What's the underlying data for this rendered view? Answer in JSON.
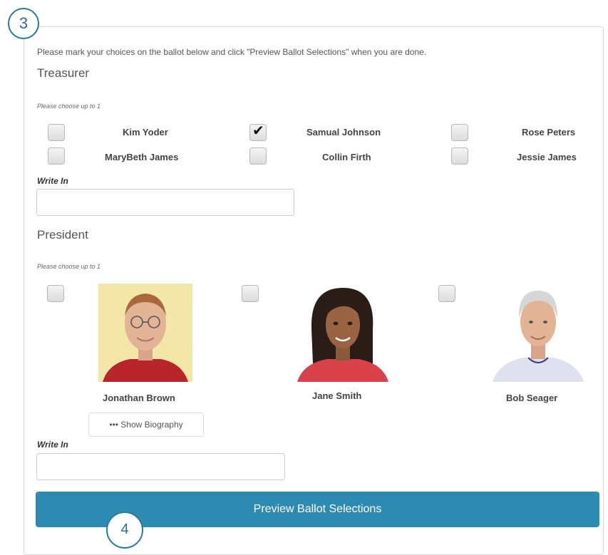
{
  "step_markers": {
    "first": "3",
    "second": "4"
  },
  "instruction": "Please mark your choices on the ballot below and click \"Preview Ballot Selections\" when you are done.",
  "treasurer": {
    "title": "Treasurer",
    "note": "Please choose up to 1",
    "candidates": [
      {
        "name": "Kim Yoder",
        "checked": false
      },
      {
        "name": "Samual Johnson",
        "checked": true
      },
      {
        "name": "Rose Peters",
        "checked": false
      },
      {
        "name": "MaryBeth James",
        "checked": false
      },
      {
        "name": "Collin Firth",
        "checked": false
      },
      {
        "name": "Jessie James",
        "checked": false
      }
    ],
    "write_in_label": "Write In",
    "write_in_value": ""
  },
  "president": {
    "title": "President",
    "note": "Please choose up to 1",
    "candidates": [
      {
        "name": "Jonathan Brown",
        "checked": false,
        "photo": "man-glasses-photo"
      },
      {
        "name": "Jane Smith",
        "checked": false,
        "photo": "woman-photo"
      },
      {
        "name": "Bob Seager",
        "checked": false,
        "photo": "elderly-man-photo"
      }
    ],
    "show_biography_label": "••• Show Biography",
    "write_in_label": "Write In",
    "write_in_value": ""
  },
  "preview_button_label": "Preview Ballot Selections",
  "check_glyph": "✔",
  "colors": {
    "accent": "#2d8ab0",
    "marker": "#2a7a9a"
  }
}
